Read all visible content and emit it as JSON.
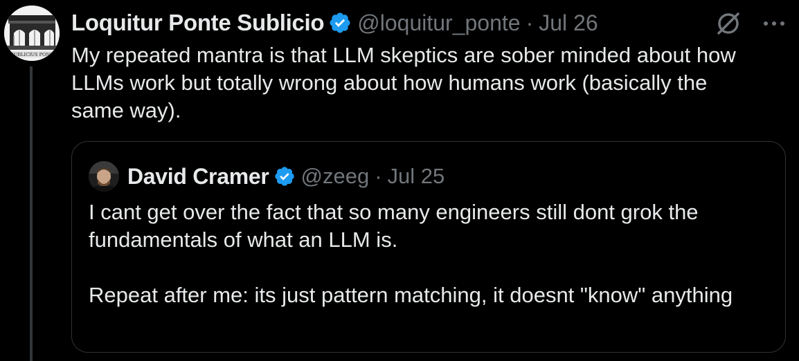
{
  "tweet": {
    "author_name": "Loquitur Ponte Sublicio",
    "handle": "@loquitur_ponte",
    "separator": "·",
    "date": "Jul 26",
    "text": "My repeated mantra is that LLM skeptics are sober minded about how LLMs work but totally wrong about how humans work (basically the same way).",
    "avatar_caption": "SUBLICIUS PONS",
    "icons": [
      "verified-badge-icon",
      "grok-slash-icon",
      "more-options-icon"
    ]
  },
  "quoted_tweet": {
    "author_name": "David Cramer",
    "handle": "@zeeg",
    "separator": "·",
    "date": "Jul 25",
    "paragraph_1": "I cant get over the fact that so many engineers still dont grok the fundamentals of what an LLM is.",
    "paragraph_2": "Repeat after me: its just pattern matching, it doesnt \"know\" anything"
  },
  "colors": {
    "background": "#000000",
    "text_primary": "#e7e9ea",
    "text_secondary": "#71767b",
    "verified_blue": "#1d9bf0",
    "border": "#2f3336"
  }
}
